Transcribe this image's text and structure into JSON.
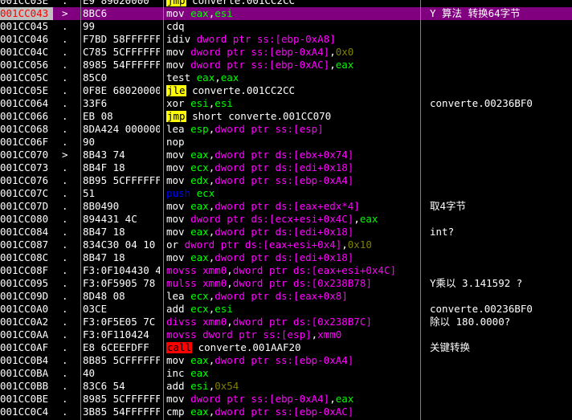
{
  "colors": {
    "background": "#000000",
    "selected_row": "#800080",
    "selected_address_bg": "#c0c0c0",
    "selected_address_fg": "#ff0000",
    "jump_highlight": "#ffff00",
    "call_highlight": "#ff0000",
    "push_text": "#0000ff",
    "sse_text": "#ff00ff",
    "register": "#00ff00",
    "memory_operand": "#ff00ff",
    "immediate": "#808000",
    "plain": "#ffffff"
  },
  "rows": [
    {
      "addr": "001CC03E",
      "mark": ".",
      "hex": "E9 89020000",
      "asm": [
        {
          "t": "jmp",
          "c": "#000",
          "bg": "#ffff00"
        },
        {
          "t": " converte.001CC2CC"
        }
      ],
      "cmt": ""
    },
    {
      "addr": "001CC043",
      "mark": ">",
      "hex": "8BC6",
      "selected": true,
      "asm": [
        {
          "t": "mov "
        },
        {
          "t": "eax",
          "c": "#00ff00"
        },
        {
          "t": ","
        },
        {
          "t": "esi",
          "c": "#00ff00"
        }
      ],
      "cmt": "Y 算法 转换64字节"
    },
    {
      "addr": "001CC045",
      "mark": ".",
      "hex": "99",
      "asm": [
        {
          "t": "cdq"
        }
      ],
      "cmt": ""
    },
    {
      "addr": "001CC046",
      "mark": ".",
      "hex": "F7BD 58FFFFFF",
      "asm": [
        {
          "t": "idiv "
        },
        {
          "t": "dword ptr ss:[ebp-0xA8]",
          "c": "#ff00ff"
        }
      ],
      "cmt": ""
    },
    {
      "addr": "001CC04C",
      "mark": ".",
      "hex": "C785 5CFFFFFF",
      "asm": [
        {
          "t": "mov "
        },
        {
          "t": "dword ptr ss:[ebp-0xA4]",
          "c": "#ff00ff"
        },
        {
          "t": ","
        },
        {
          "t": "0x0",
          "c": "#808000"
        }
      ],
      "cmt": ""
    },
    {
      "addr": "001CC056",
      "mark": ".",
      "hex": "8985 54FFFFFF",
      "asm": [
        {
          "t": "mov "
        },
        {
          "t": "dword ptr ss:[ebp-0xAC]",
          "c": "#ff00ff"
        },
        {
          "t": ","
        },
        {
          "t": "eax",
          "c": "#00ff00"
        }
      ],
      "cmt": ""
    },
    {
      "addr": "001CC05C",
      "mark": ".",
      "hex": "85C0",
      "asm": [
        {
          "t": "test "
        },
        {
          "t": "eax",
          "c": "#00ff00"
        },
        {
          "t": ","
        },
        {
          "t": "eax",
          "c": "#00ff00"
        }
      ],
      "cmt": ""
    },
    {
      "addr": "001CC05E",
      "mark": ".",
      "hex": "0F8E 68020000",
      "asm": [
        {
          "t": "jle",
          "c": "#000",
          "bg": "#ffff00"
        },
        {
          "t": " converte.001CC2CC"
        }
      ],
      "cmt": ""
    },
    {
      "addr": "001CC064",
      "mark": ".",
      "hex": "33F6",
      "asm": [
        {
          "t": "xor "
        },
        {
          "t": "esi",
          "c": "#00ff00"
        },
        {
          "t": ","
        },
        {
          "t": "esi",
          "c": "#00ff00"
        }
      ],
      "cmt": "converte.00236BF0"
    },
    {
      "addr": "001CC066",
      "mark": ".",
      "hex": "EB 08",
      "asm": [
        {
          "t": "jmp",
          "c": "#000",
          "bg": "#ffff00"
        },
        {
          "t": " short converte.001CC070"
        }
      ],
      "cmt": ""
    },
    {
      "addr": "001CC068",
      "mark": ".",
      "hex": "8DA424 000000",
      "asm": [
        {
          "t": "lea "
        },
        {
          "t": "esp",
          "c": "#00ff00"
        },
        {
          "t": ","
        },
        {
          "t": "dword ptr ss:[esp]",
          "c": "#ff00ff"
        }
      ],
      "cmt": ""
    },
    {
      "addr": "001CC06F",
      "mark": ".",
      "hex": "90",
      "asm": [
        {
          "t": "nop"
        }
      ],
      "cmt": ""
    },
    {
      "addr": "001CC070",
      "mark": ">",
      "hex": "8B43 74",
      "asm": [
        {
          "t": "mov "
        },
        {
          "t": "eax",
          "c": "#00ff00"
        },
        {
          "t": ","
        },
        {
          "t": "dword ptr ds:[ebx+0x74]",
          "c": "#ff00ff"
        }
      ],
      "cmt": ""
    },
    {
      "addr": "001CC073",
      "mark": ".",
      "hex": "8B4F 18",
      "asm": [
        {
          "t": "mov "
        },
        {
          "t": "ecx",
          "c": "#00ff00"
        },
        {
          "t": ","
        },
        {
          "t": "dword ptr ds:[edi+0x18]",
          "c": "#ff00ff"
        }
      ],
      "cmt": ""
    },
    {
      "addr": "001CC076",
      "mark": ".",
      "hex": "8B95 5CFFFFFF",
      "asm": [
        {
          "t": "mov "
        },
        {
          "t": "edx",
          "c": "#00ff00"
        },
        {
          "t": ","
        },
        {
          "t": "dword ptr ss:[ebp-0xA4]",
          "c": "#ff00ff"
        }
      ],
      "cmt": ""
    },
    {
      "addr": "001CC07C",
      "mark": ".",
      "hex": "51",
      "asm": [
        {
          "t": "push ",
          "c": "#0000ff"
        },
        {
          "t": "ecx",
          "c": "#00ff00"
        }
      ],
      "cmt": ""
    },
    {
      "addr": "001CC07D",
      "mark": ".",
      "hex": "8B0490",
      "asm": [
        {
          "t": "mov "
        },
        {
          "t": "eax",
          "c": "#00ff00"
        },
        {
          "t": ","
        },
        {
          "t": "dword ptr ds:[eax+edx*4]",
          "c": "#ff00ff"
        }
      ],
      "cmt": "取4字节"
    },
    {
      "addr": "001CC080",
      "mark": ".",
      "hex": "894431 4C",
      "asm": [
        {
          "t": "mov "
        },
        {
          "t": "dword ptr ds:[ecx+esi+0x4C]",
          "c": "#ff00ff"
        },
        {
          "t": ","
        },
        {
          "t": "eax",
          "c": "#00ff00"
        }
      ],
      "cmt": ""
    },
    {
      "addr": "001CC084",
      "mark": ".",
      "hex": "8B47 18",
      "asm": [
        {
          "t": "mov "
        },
        {
          "t": "eax",
          "c": "#00ff00"
        },
        {
          "t": ","
        },
        {
          "t": "dword ptr ds:[edi+0x18]",
          "c": "#ff00ff"
        }
      ],
      "cmt": "int?"
    },
    {
      "addr": "001CC087",
      "mark": ".",
      "hex": "834C30 04 10",
      "asm": [
        {
          "t": "or "
        },
        {
          "t": "dword ptr ds:[eax+esi+0x4]",
          "c": "#ff00ff"
        },
        {
          "t": ","
        },
        {
          "t": "0x10",
          "c": "#808000"
        }
      ],
      "cmt": ""
    },
    {
      "addr": "001CC08C",
      "mark": ".",
      "hex": "8B47 18",
      "asm": [
        {
          "t": "mov "
        },
        {
          "t": "eax",
          "c": "#00ff00"
        },
        {
          "t": ","
        },
        {
          "t": "dword ptr ds:[edi+0x18]",
          "c": "#ff00ff"
        }
      ],
      "cmt": ""
    },
    {
      "addr": "001CC08F",
      "mark": ".",
      "hex": "F3:0F104430 4C",
      "asm": [
        {
          "t": "movss ",
          "c": "#ff00ff"
        },
        {
          "t": "xmm0",
          "c": "#ff00ff"
        },
        {
          "t": ","
        },
        {
          "t": "dword ptr ds:[eax+esi+0x4C]",
          "c": "#ff00ff"
        }
      ],
      "cmt": ""
    },
    {
      "addr": "001CC095",
      "mark": ".",
      "hex": "F3:0F5905 78",
      "asm": [
        {
          "t": "mulss ",
          "c": "#ff00ff"
        },
        {
          "t": "xmm0",
          "c": "#ff00ff"
        },
        {
          "t": ","
        },
        {
          "t": "dword ptr ds:[0x238B78]",
          "c": "#ff00ff"
        }
      ],
      "cmt": "Y乘以 3.141592 ?"
    },
    {
      "addr": "001CC09D",
      "mark": ".",
      "hex": "8D48 08",
      "asm": [
        {
          "t": "lea "
        },
        {
          "t": "ecx",
          "c": "#00ff00"
        },
        {
          "t": ","
        },
        {
          "t": "dword ptr ds:[eax+0x8]",
          "c": "#ff00ff"
        }
      ],
      "cmt": ""
    },
    {
      "addr": "001CC0A0",
      "mark": ".",
      "hex": "03CE",
      "asm": [
        {
          "t": "add "
        },
        {
          "t": "ecx",
          "c": "#00ff00"
        },
        {
          "t": ","
        },
        {
          "t": "esi",
          "c": "#00ff00"
        }
      ],
      "cmt": "converte.00236BF0"
    },
    {
      "addr": "001CC0A2",
      "mark": ".",
      "hex": "F3:0F5E05 7C",
      "asm": [
        {
          "t": "divss ",
          "c": "#ff00ff"
        },
        {
          "t": "xmm0",
          "c": "#ff00ff"
        },
        {
          "t": ","
        },
        {
          "t": "dword ptr ds:[0x238B7C]",
          "c": "#ff00ff"
        }
      ],
      "cmt": "除以 180.0000?"
    },
    {
      "addr": "001CC0AA",
      "mark": ".",
      "hex": "F3:0F110424",
      "asm": [
        {
          "t": "movss ",
          "c": "#ff00ff"
        },
        {
          "t": "dword ptr ss:[esp]",
          "c": "#ff00ff"
        },
        {
          "t": ","
        },
        {
          "t": "xmm0",
          "c": "#ff00ff"
        }
      ],
      "cmt": ""
    },
    {
      "addr": "001CC0AF",
      "mark": ".",
      "hex": "E8 6CEEFDFF",
      "asm": [
        {
          "t": "call",
          "c": "#000",
          "bg": "#ff0000"
        },
        {
          "t": " converte.001AAF20"
        }
      ],
      "cmt": "关键转换"
    },
    {
      "addr": "001CC0B4",
      "mark": ".",
      "hex": "8B85 5CFFFFFF",
      "asm": [
        {
          "t": "mov "
        },
        {
          "t": "eax",
          "c": "#00ff00"
        },
        {
          "t": ","
        },
        {
          "t": "dword ptr ss:[ebp-0xA4]",
          "c": "#ff00ff"
        }
      ],
      "cmt": ""
    },
    {
      "addr": "001CC0BA",
      "mark": ".",
      "hex": "40",
      "asm": [
        {
          "t": "inc "
        },
        {
          "t": "eax",
          "c": "#00ff00"
        }
      ],
      "cmt": ""
    },
    {
      "addr": "001CC0BB",
      "mark": ".",
      "hex": "83C6 54",
      "asm": [
        {
          "t": "add "
        },
        {
          "t": "esi",
          "c": "#00ff00"
        },
        {
          "t": ","
        },
        {
          "t": "0x54",
          "c": "#808000"
        }
      ],
      "cmt": ""
    },
    {
      "addr": "001CC0BE",
      "mark": ".",
      "hex": "8985 5CFFFFFF",
      "asm": [
        {
          "t": "mov "
        },
        {
          "t": "dword ptr ss:[ebp-0xA4]",
          "c": "#ff00ff"
        },
        {
          "t": ","
        },
        {
          "t": "eax",
          "c": "#00ff00"
        }
      ],
      "cmt": ""
    },
    {
      "addr": "001CC0C4",
      "mark": ".",
      "hex": "3B85 54FFFFFF",
      "asm": [
        {
          "t": "cmp "
        },
        {
          "t": "eax",
          "c": "#00ff00"
        },
        {
          "t": ","
        },
        {
          "t": "dword ptr ss:[ebp-0xAC]",
          "c": "#ff00ff"
        }
      ],
      "cmt": ""
    }
  ]
}
